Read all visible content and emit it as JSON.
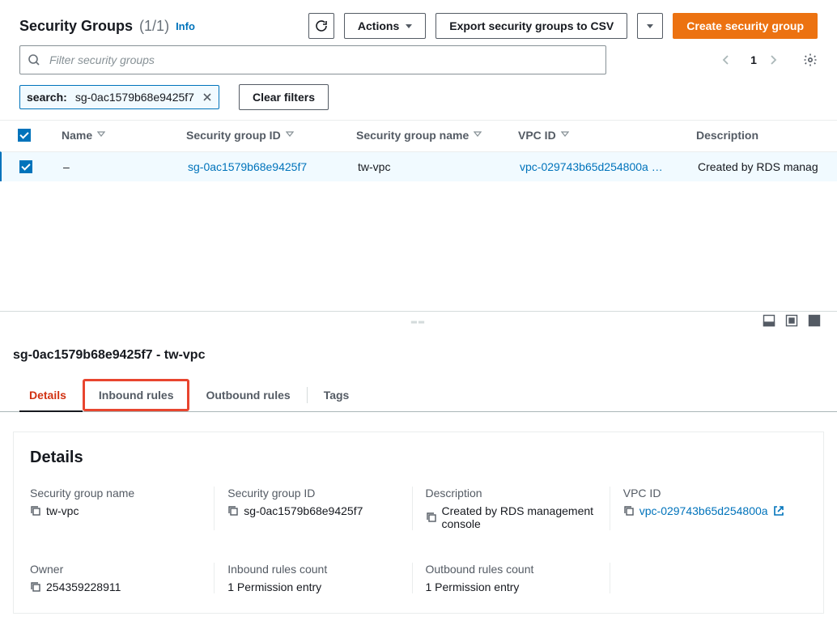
{
  "header": {
    "title": "Security Groups",
    "count": "(1/1)",
    "info": "Info",
    "refresh_aria": "Refresh",
    "actions_label": "Actions",
    "export_label": "Export security groups to CSV",
    "create_label": "Create security group"
  },
  "search": {
    "placeholder": "Filter security groups"
  },
  "pagination": {
    "page": "1"
  },
  "filter_chip": {
    "key": "search:",
    "value": "sg-0ac1579b68e9425f7",
    "clear_label": "Clear filters"
  },
  "table": {
    "columns": {
      "name": "Name",
      "sgid": "Security group ID",
      "sgname": "Security group name",
      "vpc": "VPC ID",
      "desc": "Description"
    },
    "rows": [
      {
        "name": "–",
        "sgid": "sg-0ac1579b68e9425f7",
        "sgname": "tw-vpc",
        "vpc": "vpc-029743b65d254800a …",
        "desc": "Created by RDS manag"
      }
    ]
  },
  "detail": {
    "title": "sg-0ac1579b68e9425f7 - tw-vpc",
    "tabs": {
      "details": "Details",
      "inbound": "Inbound rules",
      "outbound": "Outbound rules",
      "tags": "Tags"
    },
    "panel_title": "Details",
    "fields": {
      "sgname_label": "Security group name",
      "sgname_value": "tw-vpc",
      "sgid_label": "Security group ID",
      "sgid_value": "sg-0ac1579b68e9425f7",
      "desc_label": "Description",
      "desc_value": "Created by RDS management console",
      "vpc_label": "VPC ID",
      "vpc_value": "vpc-029743b65d254800a",
      "owner_label": "Owner",
      "owner_value": "254359228911",
      "inbound_count_label": "Inbound rules count",
      "inbound_count_value": "1 Permission entry",
      "outbound_count_label": "Outbound rules count",
      "outbound_count_value": "1 Permission entry"
    }
  }
}
